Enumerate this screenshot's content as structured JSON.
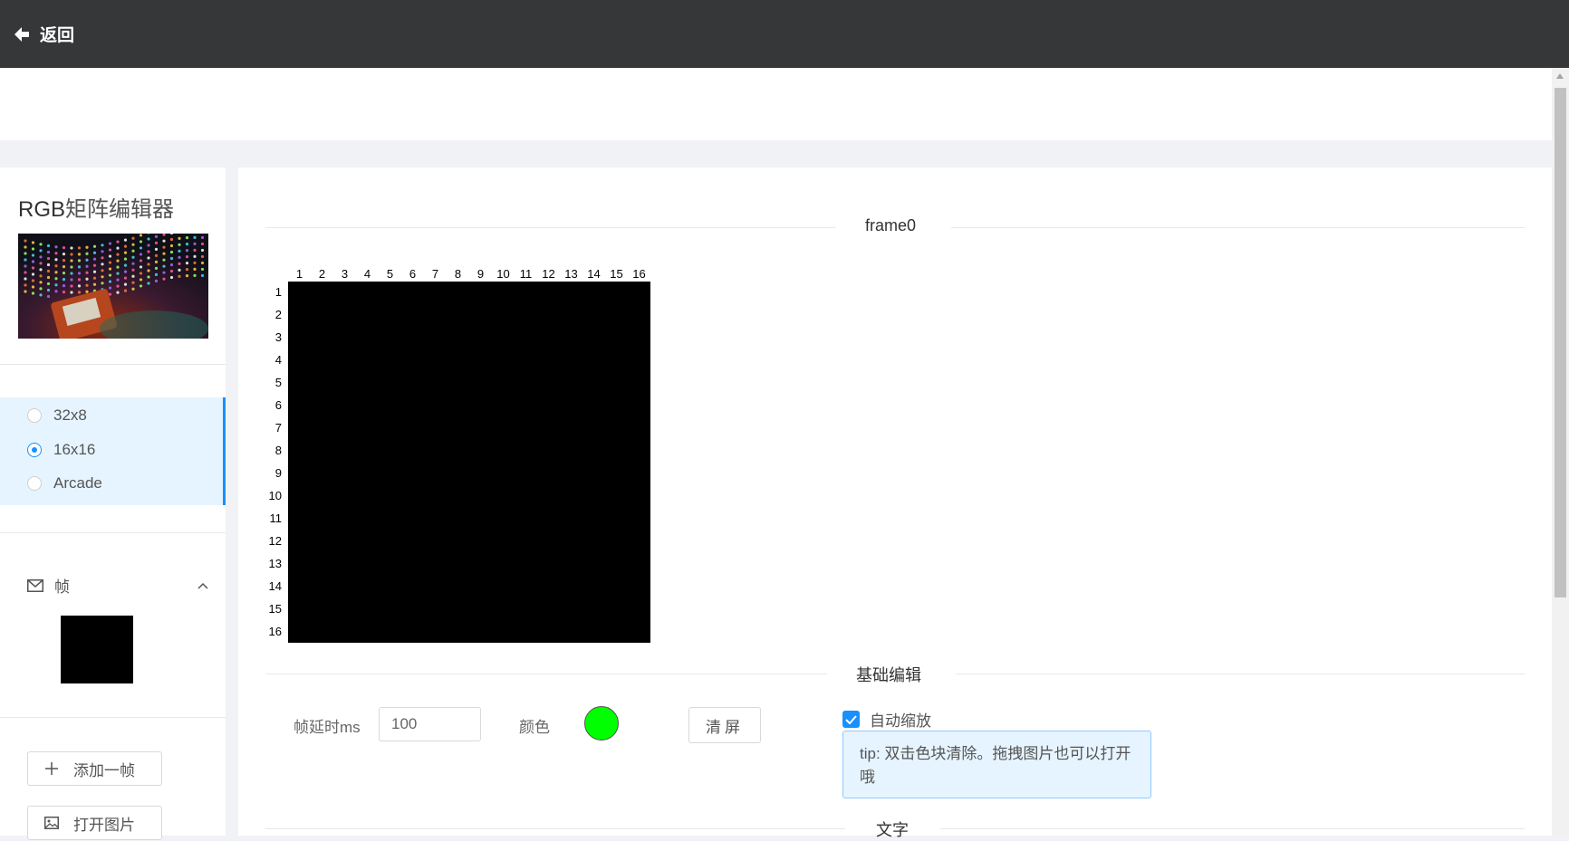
{
  "topbar": {
    "back_label": "返回"
  },
  "sidebar": {
    "title_prefix": "RGB",
    "title_suffix": "矩阵编辑器",
    "size_options": [
      "32x8",
      "16x16",
      "Arcade"
    ],
    "selected_size": "16x16",
    "frames_label": "帧",
    "add_frame_label": "添加一帧",
    "open_image_label": "打开图片"
  },
  "main": {
    "frame_title": "frame0",
    "col_numbers": [
      "1",
      "2",
      "3",
      "4",
      "5",
      "6",
      "7",
      "8",
      "9",
      "10",
      "11",
      "12",
      "13",
      "14",
      "15",
      "16"
    ],
    "row_numbers": [
      "1",
      "2",
      "3",
      "4",
      "5",
      "6",
      "7",
      "8",
      "9",
      "10",
      "11",
      "12",
      "13",
      "14",
      "15",
      "16"
    ],
    "basic_edit_title": "基础编辑",
    "delay_label": "帧延时ms",
    "delay_value": "100",
    "color_label": "颜色",
    "color_value": "#00ff00",
    "clear_label": "清屏",
    "autozoom_label": "自动缩放",
    "autozoom_checked": true,
    "tip_text": "tip: 双击色块清除。拖拽图片也可以打开哦",
    "text_section_title": "文字"
  },
  "colors": {
    "topbar_bg": "#363738",
    "accent": "#1890ff",
    "matrix_bg": "#000000"
  }
}
